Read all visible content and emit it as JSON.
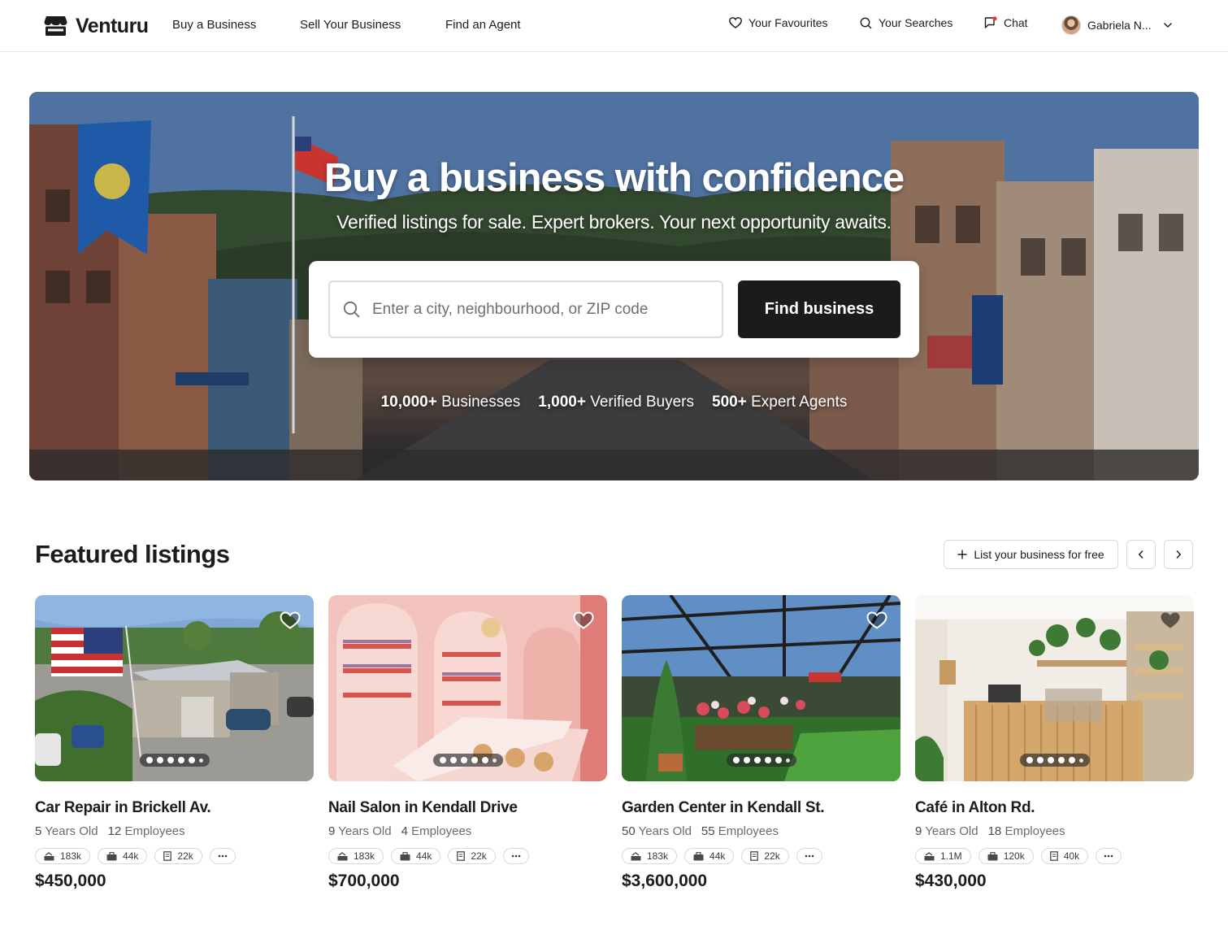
{
  "brand": {
    "name": "Venturu"
  },
  "nav": {
    "buy": "Buy a Business",
    "sell": "Sell Your Business",
    "agent": "Find an Agent",
    "favourites": "Your Favourites",
    "searches": "Your Searches",
    "chat": "Chat",
    "user": "Gabriela N..."
  },
  "hero": {
    "title": "Buy a business with confidence",
    "subtitle": "Verified listings for sale. Expert brokers. Your next opportunity awaits.",
    "search_placeholder": "Enter a city, neighbourhood, or ZIP code",
    "search_button": "Find business",
    "stats": [
      {
        "value": "10,000+",
        "label": "Businesses"
      },
      {
        "value": "1,000+",
        "label": "Verified Buyers"
      },
      {
        "value": "500+",
        "label": "Expert Agents"
      }
    ]
  },
  "featured": {
    "title": "Featured listings",
    "list_free": "List your business for free",
    "listings": [
      {
        "title": "Car Repair in Brickell Av.",
        "years": "5",
        "years_label": "Years Old",
        "employees": "12",
        "employees_label": "Employees",
        "revenue": "183k",
        "cashflow": "44k",
        "expenses": "22k",
        "price": "$450,000"
      },
      {
        "title": "Nail Salon in Kendall Drive",
        "years": "9",
        "years_label": "Years Old",
        "employees": "4",
        "employees_label": "Employees",
        "revenue": "183k",
        "cashflow": "44k",
        "expenses": "22k",
        "price": "$700,000"
      },
      {
        "title": "Garden Center in Kendall St.",
        "years": "50",
        "years_label": "Years Old",
        "employees": "55",
        "employees_label": "Employees",
        "revenue": "183k",
        "cashflow": "44k",
        "expenses": "22k",
        "price": "$3,600,000"
      },
      {
        "title": "Café in Alton Rd.",
        "years": "9",
        "years_label": "Years Old",
        "employees": "18",
        "employees_label": "Employees",
        "revenue": "1.1M",
        "cashflow": "120k",
        "expenses": "40k",
        "price": "$430,000"
      }
    ]
  }
}
